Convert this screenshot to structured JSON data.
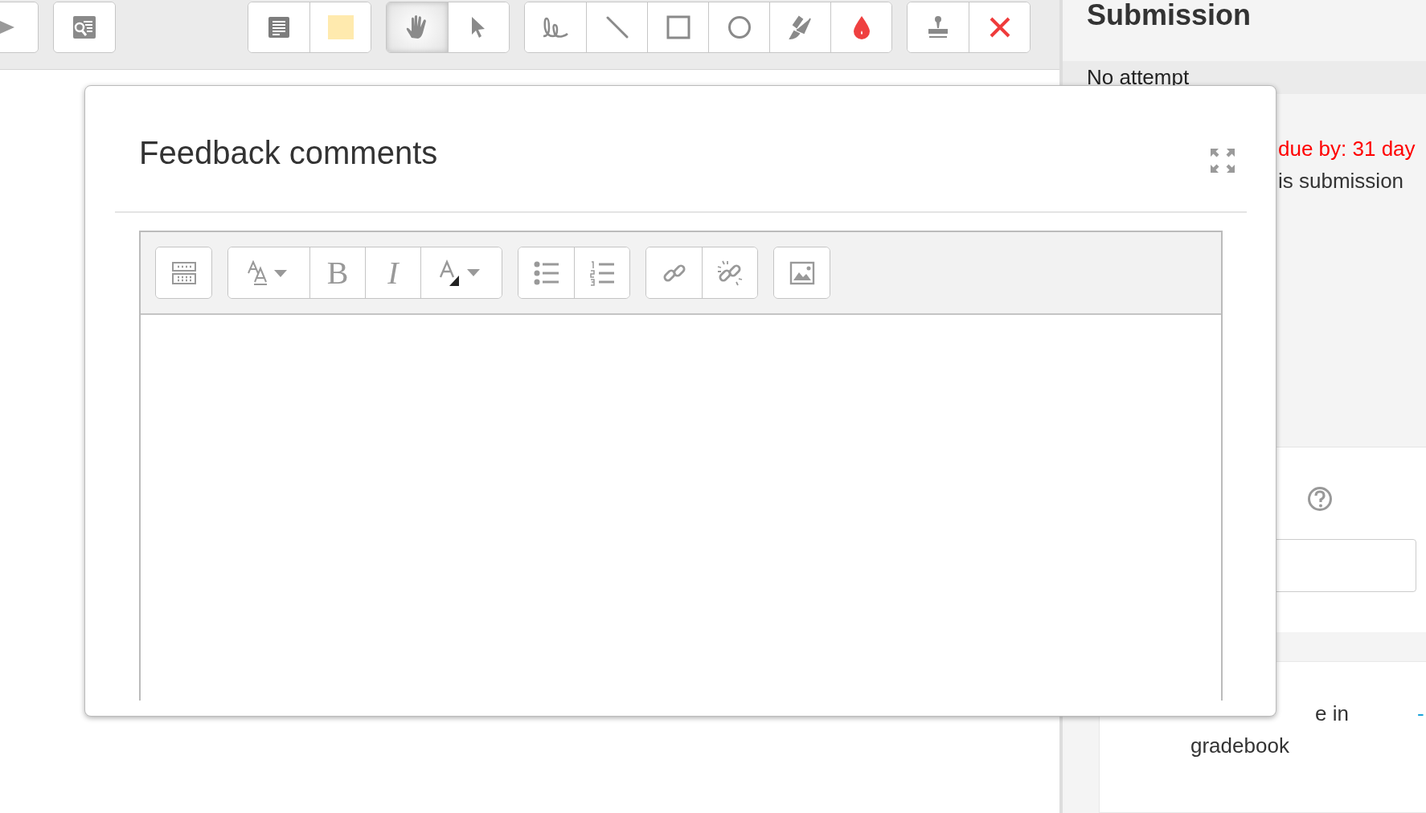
{
  "toolbar": {
    "groups": [
      [
        {
          "kind": "play",
          "selected": false
        }
      ],
      [
        {
          "kind": "search-page",
          "selected": false
        }
      ],
      [
        {
          "kind": "comment",
          "selected": false
        },
        {
          "kind": "note-color",
          "selected": false,
          "color": "#ffeaae"
        }
      ],
      [
        {
          "kind": "hand",
          "selected": true
        },
        {
          "kind": "pointer",
          "selected": false
        }
      ],
      [
        {
          "kind": "pen",
          "selected": false
        },
        {
          "kind": "line",
          "selected": false
        },
        {
          "kind": "rectangle",
          "selected": false
        },
        {
          "kind": "oval",
          "selected": false
        },
        {
          "kind": "highlighter",
          "selected": false
        },
        {
          "kind": "ink-color",
          "selected": false,
          "color": "#ef4040"
        }
      ],
      [
        {
          "kind": "stamp",
          "selected": false
        },
        {
          "kind": "delete",
          "selected": false
        }
      ]
    ]
  },
  "side_panel": {
    "heading": "Submission",
    "status": "No attempt",
    "due": "due by: 31 day",
    "note": "is submission",
    "grade_label": "e in",
    "grade_label_2": "gradebook",
    "grade_value": "-"
  },
  "dialog": {
    "title": "Feedback comments",
    "editor_toolbar": [
      [
        {
          "kind": "toggle-toolbar"
        }
      ],
      [
        {
          "kind": "font-size"
        },
        {
          "kind": "bold",
          "glyph": "B"
        },
        {
          "kind": "italic",
          "glyph": "I"
        },
        {
          "kind": "font-color"
        }
      ],
      [
        {
          "kind": "bullet-list"
        },
        {
          "kind": "number-list"
        }
      ],
      [
        {
          "kind": "link"
        },
        {
          "kind": "unlink"
        }
      ],
      [
        {
          "kind": "image"
        }
      ]
    ]
  }
}
